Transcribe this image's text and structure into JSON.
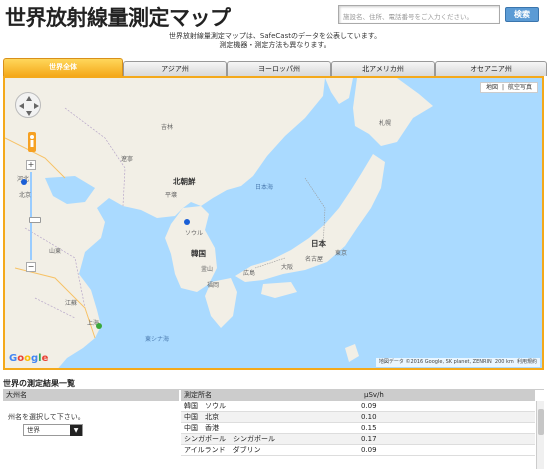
{
  "page": {
    "title": "世界放射線量測定マップ",
    "description_line1": "世界放射線量測定マップは、SafeCastのデータを公表しています。",
    "description_line2": "測定機器・測定方法も異なります。"
  },
  "search": {
    "placeholder": "施設名、住所、電話番号をご入力ください。",
    "button_label": "検索"
  },
  "tabs": [
    {
      "label": "世界全体",
      "active": true
    },
    {
      "label": "アジア州",
      "active": false
    },
    {
      "label": "ヨーロッパ州",
      "active": false
    },
    {
      "label": "北アメリカ州",
      "active": false
    },
    {
      "label": "オセアニア州",
      "active": false
    }
  ],
  "map": {
    "type_map": "地図",
    "type_satellite": "航空写真",
    "attribution": "地図データ ©2016 Google, SK planet, ZENRIN",
    "scale": "200 km",
    "terms": "利用規約",
    "logo": "Google",
    "labels": {
      "japan": "日本",
      "korea": "韓国",
      "north_korea": "北朝鮮",
      "sea_of_japan": "日本海",
      "east_china_sea": "東シナ海",
      "sapporo": "札幌",
      "seoul": "ソウル",
      "pyongyang": "平壌",
      "tokyo": "東京",
      "osaka": "大阪",
      "nagoya": "名古屋",
      "hiroshima": "広島",
      "fukuoka": "福岡",
      "shanghai": "上海",
      "busan": "釜山",
      "jilin": "吉林",
      "liaoning": "遼寧",
      "shandong": "山東",
      "jiangsu": "江蘇",
      "hebei": "河北",
      "beijing": "北京"
    },
    "colors": {
      "sea": "#aadaff",
      "land": "#f2efe6",
      "marker_blue": "#1a5fd6",
      "marker_green": "#3ba83b",
      "frame": "#f4a91b"
    }
  },
  "results": {
    "section_title": "世界の測定結果一覧",
    "headers": {
      "region": "大州名",
      "location": "測定所名",
      "value": "μSv/h"
    },
    "region_note": "州名を選択して下さい。",
    "region_select": "世界",
    "rows": [
      {
        "location": "韓国　ソウル",
        "value": "0.09"
      },
      {
        "location": "中国　北京",
        "value": "0.10"
      },
      {
        "location": "中国　香港",
        "value": "0.15"
      },
      {
        "location": "シンガポール　シンガポール",
        "value": "0.17"
      },
      {
        "location": "アイルランド　ダブリン",
        "value": "0.09"
      }
    ]
  }
}
